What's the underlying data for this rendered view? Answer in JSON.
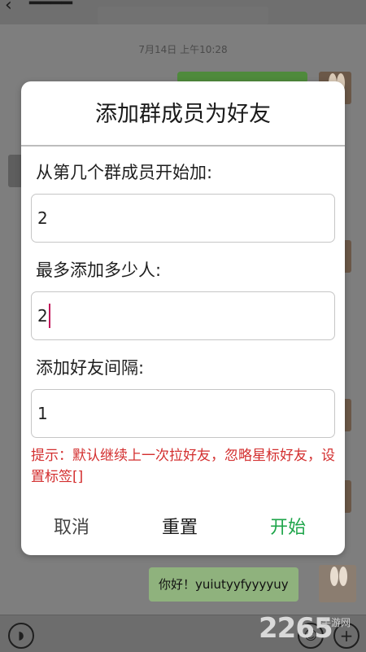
{
  "background_chat": {
    "time_label": "7月14日 上午10:28",
    "last_message": "你好！yuiutyyfyyyyuy",
    "watermark": "2265",
    "watermark_sub": "手游网"
  },
  "dialog": {
    "title": "添加群成员为好友",
    "fields": [
      {
        "label": "从第几个群成员开始加:",
        "value": "2"
      },
      {
        "label": "最多添加多少人:",
        "value": "2"
      },
      {
        "label": "添加好友间隔:",
        "value": "1"
      }
    ],
    "hint": "提示：默认继续上一次拉好友，忽略星标好友，设置标签[]",
    "buttons": {
      "cancel": "取消",
      "reset": "重置",
      "start": "开始"
    }
  },
  "colors": {
    "start_button": "#1ea54a",
    "hint_text": "#d32f2f",
    "caret": "#c2185b"
  }
}
